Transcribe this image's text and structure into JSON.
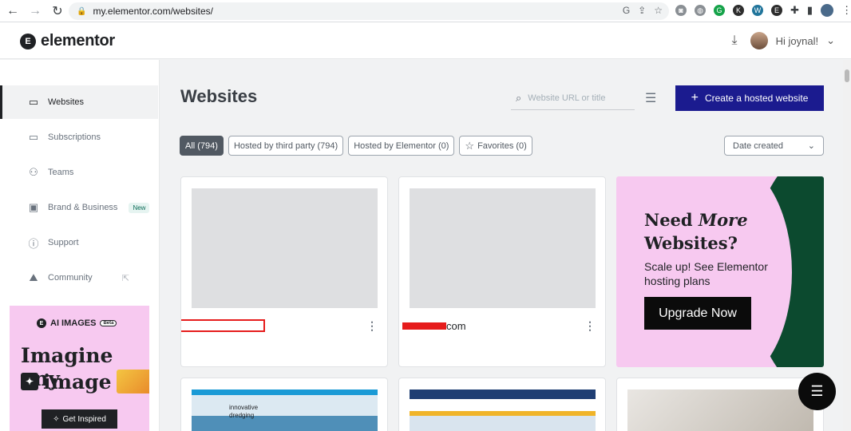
{
  "browser": {
    "url": "my.elementor.com/websites/"
  },
  "header": {
    "logo_text": "elementor",
    "greeting": "Hi joynal!"
  },
  "sidebar": {
    "items": [
      {
        "label": "Websites",
        "icon": "browser-window-icon",
        "active": true
      },
      {
        "label": "Subscriptions",
        "icon": "card-icon"
      },
      {
        "label": "Teams",
        "icon": "people-icon"
      },
      {
        "label": "Brand & Business",
        "icon": "briefcase-icon",
        "badge": "New"
      },
      {
        "label": "Support",
        "icon": "info-icon"
      },
      {
        "label": "Community",
        "icon": "community-icon"
      }
    ],
    "promo": {
      "brand": "AI IMAGES",
      "badge": "Beta",
      "line1": "Imagine any",
      "line2": "image",
      "cta": "Get Inspired"
    }
  },
  "main": {
    "title": "Websites",
    "search_placeholder": "Website URL or title",
    "create_label": "Create a hosted website",
    "filters": [
      {
        "label": "All (794)",
        "active": true
      },
      {
        "label": "Hosted by third party (794)"
      },
      {
        "label": "Hosted by Elementor (0)"
      },
      {
        "label": "Favorites (0)"
      }
    ],
    "sort_selected": "Date created",
    "cards": [
      {
        "name": ""
      },
      {
        "name": "com"
      }
    ],
    "upgrade": {
      "headline_a": "Need ",
      "headline_em": "More",
      "headline_b": "Websites?",
      "sub": "Scale up! See Elementor hosting plans",
      "cta": "Upgrade Now"
    },
    "thumb_text": "innovative dredging"
  },
  "colors": {
    "accent": "#1b1b8f",
    "promo_pink": "#f7c9f0",
    "promo_green": "#0c4a2f",
    "redaction": "#e61c1c"
  }
}
